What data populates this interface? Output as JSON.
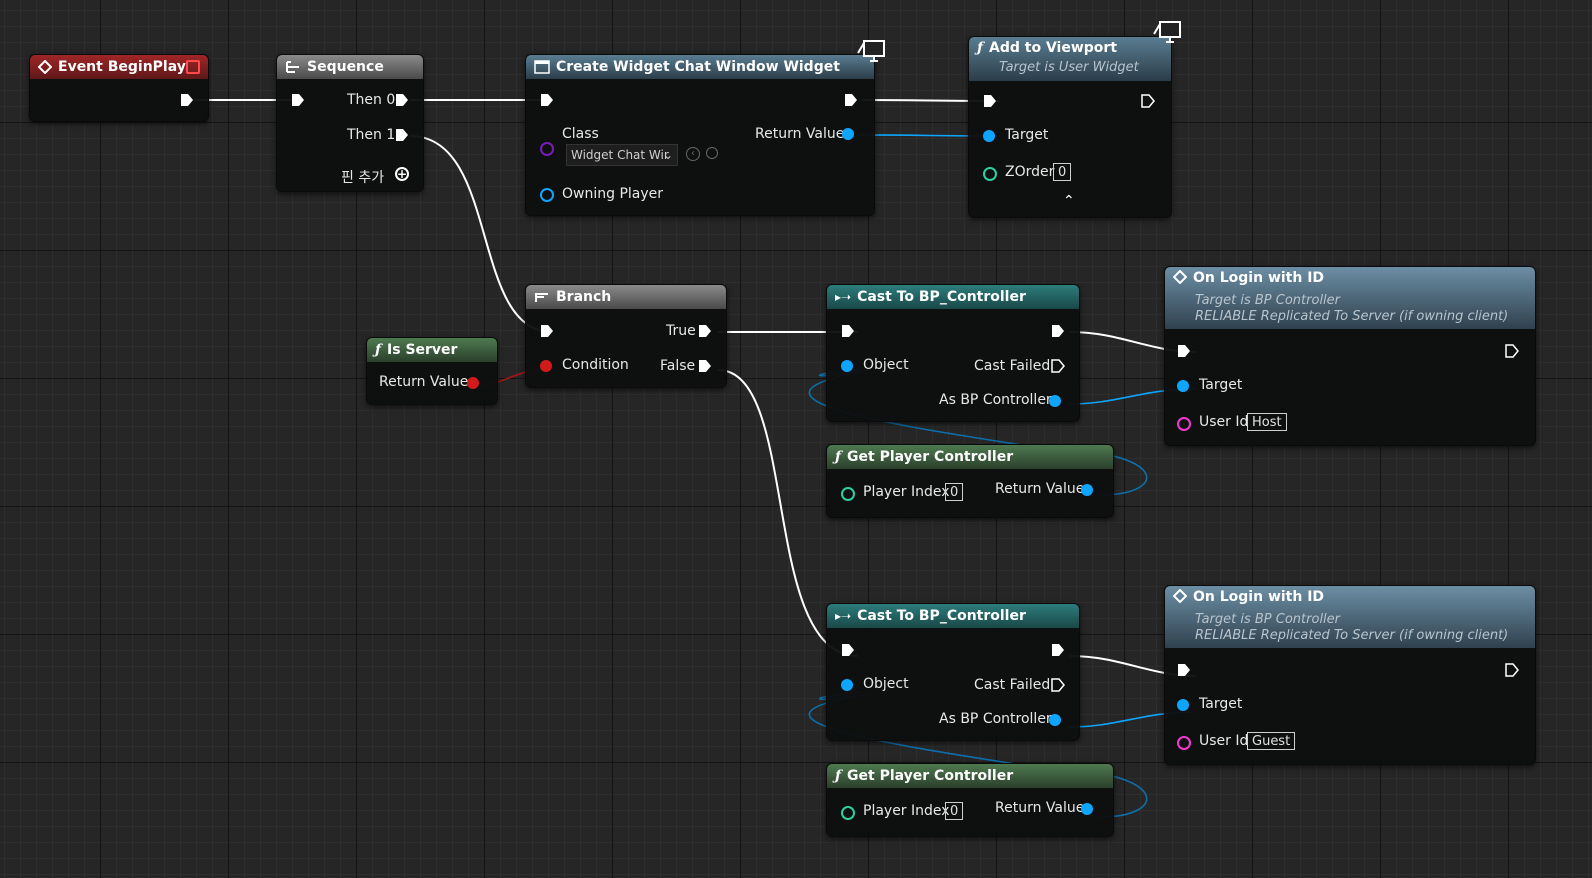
{
  "colors": {
    "exec": "#ffffff",
    "object": "#0ea5ff",
    "bool": "#d11a1a",
    "int": "#2fd0a0",
    "class": "#8f1fd6",
    "string": "#f23ad2"
  },
  "nodes": {
    "begin_play": {
      "title": "Event BeginPlay"
    },
    "sequence": {
      "title": "Sequence",
      "then0": "Then 0",
      "then1": "Then 1",
      "add_pin": "핀 추가"
    },
    "create_widget": {
      "title": "Create Widget Chat Window Widget",
      "class_label": "Class",
      "class_value": "Widget Chat Wir",
      "return_value": "Return Value",
      "owning_player": "Owning Player"
    },
    "add_viewport": {
      "title": "Add to Viewport",
      "subtitle": "Target is User Widget",
      "target": "Target",
      "zorder": "ZOrder",
      "zorder_value": "0"
    },
    "branch": {
      "title": "Branch",
      "true_label": "True",
      "false_label": "False",
      "condition": "Condition"
    },
    "is_server": {
      "title": "Is Server",
      "return_value": "Return Value"
    },
    "cast1": {
      "title": "Cast To BP_Controller",
      "object": "Object",
      "cast_failed": "Cast Failed",
      "as_bp": "As BP Controller"
    },
    "get_pc1": {
      "title": "Get Player Controller",
      "player_index": "Player Index",
      "player_index_value": "0",
      "return_value": "Return Value"
    },
    "login1": {
      "title": "On Login with ID",
      "subtitle1": "Target is BP Controller",
      "subtitle2": "RELIABLE Replicated To Server (if owning client)",
      "target": "Target",
      "user_id": "User Id",
      "user_id_value": "Host"
    },
    "cast2": {
      "title": "Cast To BP_Controller",
      "object": "Object",
      "cast_failed": "Cast Failed",
      "as_bp": "As BP Controller"
    },
    "get_pc2": {
      "title": "Get Player Controller",
      "player_index": "Player Index",
      "player_index_value": "0",
      "return_value": "Return Value"
    },
    "login2": {
      "title": "On Login with ID",
      "subtitle1": "Target is BP Controller",
      "subtitle2": "RELIABLE Replicated To Server (if owning client)",
      "target": "Target",
      "user_id": "User Id",
      "user_id_value": "Guest"
    }
  }
}
